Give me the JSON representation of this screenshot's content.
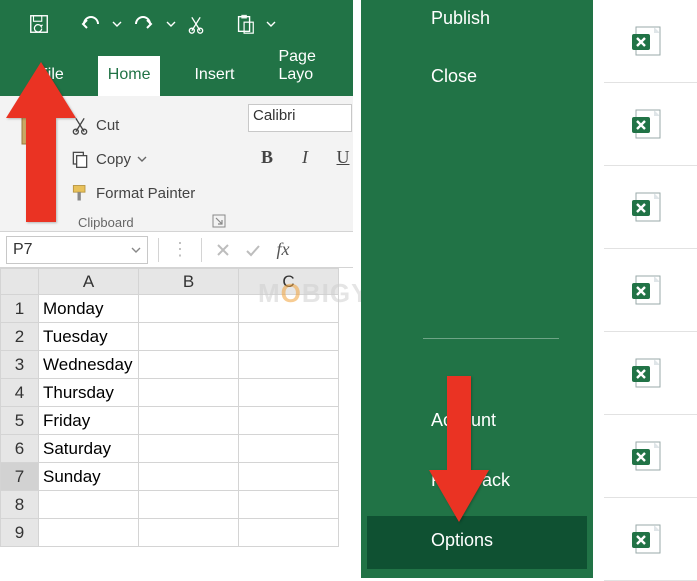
{
  "colors": {
    "brand": "#217346",
    "accent_red": "#EA3323"
  },
  "qat": {
    "save_refresh": "save-refresh",
    "undo": "undo",
    "redo": "redo",
    "cut": "cut",
    "paste": "paste"
  },
  "tabs": {
    "file": "File",
    "home": "Home",
    "insert": "Insert",
    "page_layout": "Page Layo"
  },
  "ribbon": {
    "paste_label": "P",
    "cut_label": "Cut",
    "copy_label": "Copy",
    "format_painter_label": "Format Painter",
    "clipboard_group": "Clipboard",
    "font_name": "Calibri",
    "bold": "B",
    "italic": "I",
    "underline": "U"
  },
  "namebox": {
    "value": "P7"
  },
  "columns": [
    "A",
    "B",
    "C"
  ],
  "rows": [
    {
      "n": "1",
      "A": "Monday"
    },
    {
      "n": "2",
      "A": "Tuesday"
    },
    {
      "n": "3",
      "A": "Wednesday"
    },
    {
      "n": "4",
      "A": "Thursday"
    },
    {
      "n": "5",
      "A": "Friday"
    },
    {
      "n": "6",
      "A": "Saturday"
    },
    {
      "n": "7",
      "A": "Sunday"
    },
    {
      "n": "8",
      "A": ""
    },
    {
      "n": "9",
      "A": ""
    }
  ],
  "selected_row": "7",
  "watermark": {
    "pre": "M",
    "o": "O",
    "post": "BIGYAAN"
  },
  "file_menu": {
    "publish": "Publish",
    "close": "Close",
    "account": "Account",
    "feedback": "Feedback",
    "options": "Options"
  },
  "recent_count": 7
}
